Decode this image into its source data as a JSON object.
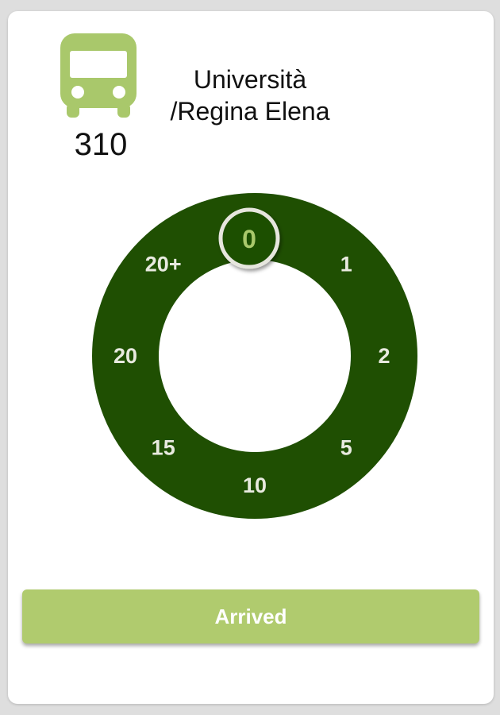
{
  "route": {
    "number": "310",
    "stop_name_line1": "Università",
    "stop_name_line2": "/Regina Elena",
    "icon": "bus-icon"
  },
  "dial": {
    "labels": [
      "0",
      "1",
      "2",
      "5",
      "10",
      "15",
      "20",
      "20+"
    ],
    "selected": "0"
  },
  "actions": {
    "arrived_label": "Arrived"
  },
  "colors": {
    "ring": "#1f4f02",
    "accent": "#b0cb6e",
    "bus_icon": "#a9c86b",
    "ring_label": "#e8eadf",
    "background": "#dedede",
    "card": "#ffffff"
  }
}
